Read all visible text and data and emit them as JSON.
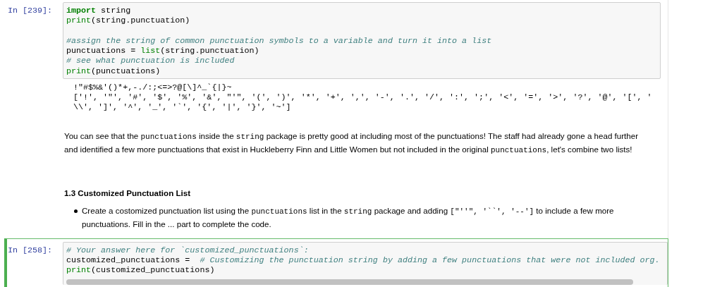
{
  "cells": [
    {
      "kind": "code",
      "prompt": "In [239]:",
      "selected": false,
      "lines": [
        {
          "kind": "code",
          "tokens": [
            {
              "kind": "keyword",
              "text": "import"
            },
            {
              "kind": "plain",
              "text": " string"
            }
          ]
        },
        {
          "kind": "code",
          "tokens": [
            {
              "kind": "builtin",
              "text": "print"
            },
            {
              "kind": "plain",
              "text": "(string.punctuation)"
            }
          ]
        },
        {
          "kind": "blank"
        },
        {
          "kind": "code",
          "tokens": [
            {
              "kind": "comment",
              "text": "#assign the string of common punctuation symbols to a variable and turn it into a list"
            }
          ]
        },
        {
          "kind": "code",
          "tokens": [
            {
              "kind": "plain",
              "text": "punctuations = "
            },
            {
              "kind": "builtin",
              "text": "list"
            },
            {
              "kind": "plain",
              "text": "(string.punctuation)"
            }
          ]
        },
        {
          "kind": "code",
          "tokens": [
            {
              "kind": "comment",
              "text": "# see what punctuation is included"
            }
          ]
        },
        {
          "kind": "code",
          "tokens": [
            {
              "kind": "builtin",
              "text": "print"
            },
            {
              "kind": "plain",
              "text": "(punctuations)"
            }
          ]
        }
      ],
      "output": [
        "!\"#$%&'()*+,-./:;<=>?@[\\]^_`{|}~",
        "['!', '\"', '#', '$', '%', '&', \"'\", '(', ')', '*', '+', ',', '-', '.', '/', ':', ';', '<', '=', '>', '?', '@', '[', '",
        "\\\\', ']', '^', '_', '`', '{', '|', '}', '~']"
      ]
    },
    {
      "kind": "markdown",
      "blocks": [
        {
          "kind": "paragraph",
          "segments": [
            {
              "kind": "text",
              "text": "You can see that the "
            },
            {
              "kind": "code",
              "text": "punctuations"
            },
            {
              "kind": "text",
              "text": " inside the "
            },
            {
              "kind": "code",
              "text": "string"
            },
            {
              "kind": "text",
              "text": " package is pretty good at including most of the punctuations! The staff had already gone a head further and identified a few more punctuations that exist in Huckleberry Finn and Little Women but not included in the original "
            },
            {
              "kind": "code",
              "text": "punctuations"
            },
            {
              "kind": "text",
              "text": ", let's combine two lists!"
            }
          ]
        },
        {
          "kind": "heading",
          "segments": [
            {
              "kind": "text",
              "text": "1.3 Customized Punctuation List"
            }
          ]
        },
        {
          "kind": "bullet",
          "segments": [
            {
              "kind": "text",
              "text": "Create a costomized punctuation list using the "
            },
            {
              "kind": "code",
              "text": "punctuations"
            },
            {
              "kind": "text",
              "text": " list in the "
            },
            {
              "kind": "code",
              "text": "string"
            },
            {
              "kind": "text",
              "text": " package and adding "
            },
            {
              "kind": "code",
              "text": "[\"''\", '``', '--']"
            },
            {
              "kind": "text",
              "text": " to include a few more punctuations. Fill in the ... part to complete the code."
            }
          ]
        }
      ]
    },
    {
      "kind": "code",
      "prompt": "In [258]:",
      "selected": true,
      "lines": [
        {
          "kind": "code",
          "tokens": [
            {
              "kind": "comment",
              "text": "# Your answer here for `customized_punctuations`:"
            }
          ]
        },
        {
          "kind": "code",
          "tokens": [
            {
              "kind": "plain",
              "text": "customized_punctuations =  "
            },
            {
              "kind": "comment",
              "text": "# Customizing the punctuation string by adding a few punctuations that were not included org."
            }
          ]
        },
        {
          "kind": "code",
          "tokens": [
            {
              "kind": "builtin",
              "text": "print"
            },
            {
              "kind": "plain",
              "text": "(customized_punctuations)"
            }
          ]
        }
      ],
      "scrollbar": true
    }
  ]
}
